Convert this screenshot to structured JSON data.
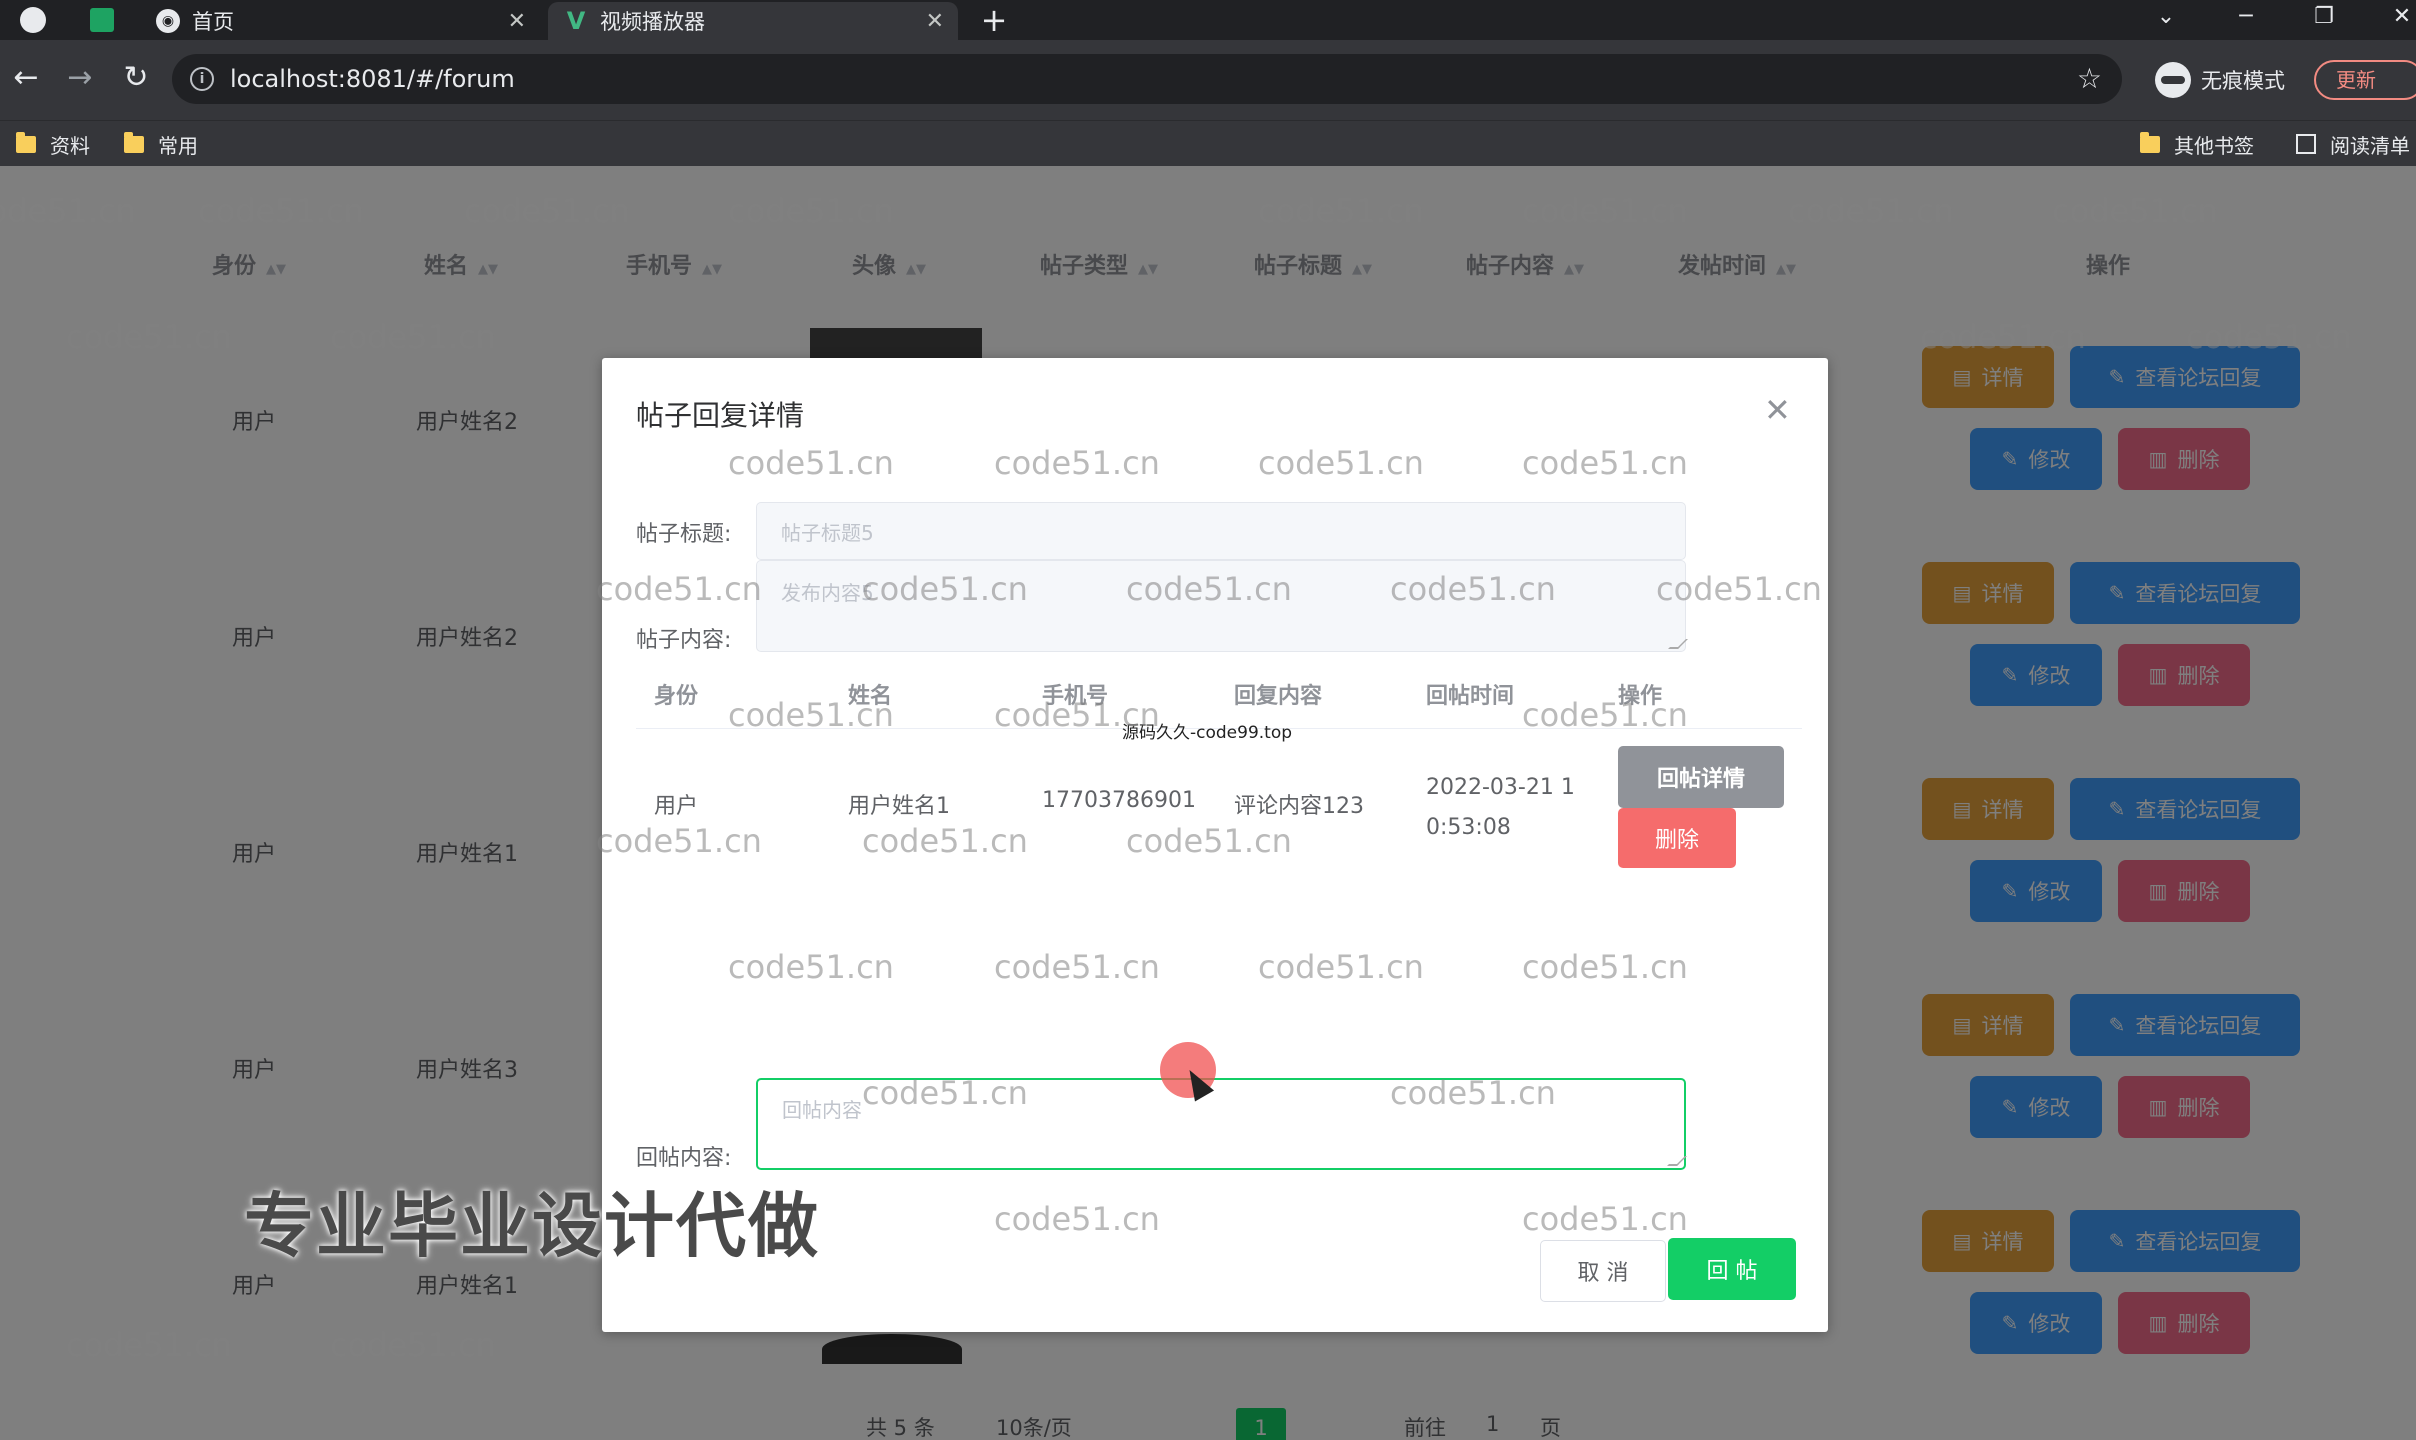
{
  "browser": {
    "tabs": [
      {
        "title": "首页",
        "favicon": "globe-icon",
        "active": false
      },
      {
        "title": "视频播放器",
        "favicon": "vue-logo-icon",
        "active": true
      }
    ],
    "url": "localhost:8081/#/forum",
    "incognito_label": "无痕模式",
    "update_label": "更新",
    "bookmarks_left": [
      "资料",
      "常用"
    ],
    "bookmarks_right": [
      "其他书签",
      "阅读清单"
    ]
  },
  "table": {
    "headers": [
      "身份",
      "姓名",
      "手机号",
      "头像",
      "帖子类型",
      "帖子标题",
      "帖子内容",
      "发帖时间",
      "操作"
    ],
    "rows": [
      {
        "identity": "用户",
        "name": "用户姓名2"
      },
      {
        "identity": "用户",
        "name": "用户姓名2"
      },
      {
        "identity": "用户",
        "name": "用户姓名1"
      },
      {
        "identity": "用户",
        "name": "用户姓名3"
      },
      {
        "identity": "用户",
        "name": "用户姓名1"
      }
    ],
    "actions": {
      "detail": "详情",
      "view_replies": "查看论坛回复",
      "edit": "修改",
      "delete": "删除"
    },
    "pagination": {
      "total": "共 5 条",
      "per_page": "10条/页",
      "current": "1",
      "goto": "前往",
      "goto_value": "1",
      "page_unit": "页"
    }
  },
  "dialog": {
    "title": "帖子回复详情",
    "post_title_label": "帖子标题:",
    "post_title_value": "帖子标题5",
    "post_content_label": "帖子内容:",
    "post_content_value": "发布内容5",
    "reply_table": {
      "headers": [
        "身份",
        "姓名",
        "手机号",
        "回复内容",
        "回帖时间",
        "操作"
      ],
      "rows": [
        {
          "identity": "用户",
          "name": "用户姓名1",
          "phone": "17703786901",
          "content": "评论内容123",
          "time": "2022-03-21 10:53:08",
          "detail_btn": "回帖详情",
          "delete_btn": "删除"
        }
      ]
    },
    "overlay_text": "源码久久-code99.top",
    "reply_label": "回帖内容:",
    "reply_placeholder": "回帖内容",
    "cancel_label": "取 消",
    "submit_label": "回 帖"
  },
  "banner_text": "专业毕业设计代做",
  "watermark": "code51.cn",
  "colors": {
    "success": "#13ce66",
    "danger": "#f56c6c",
    "info": "#909399",
    "warning": "#e6a23c",
    "primary": "#409eff"
  }
}
